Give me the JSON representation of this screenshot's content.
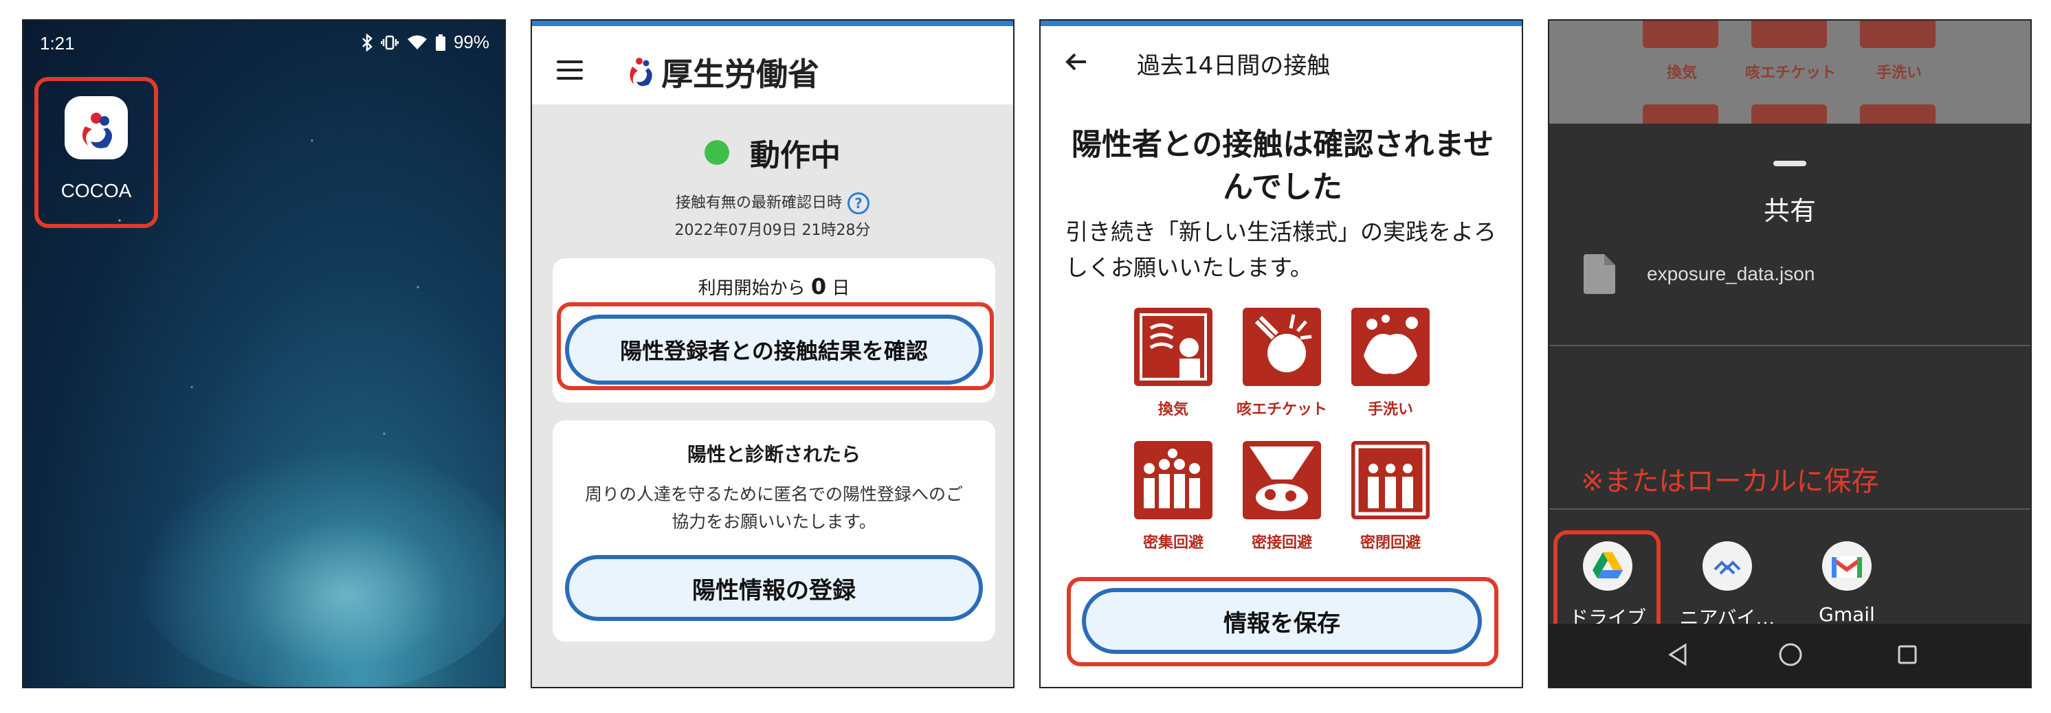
{
  "home": {
    "status_time": "1:21",
    "battery": "99%",
    "app_label": "COCOA"
  },
  "main": {
    "logo_text": "厚生労働省",
    "status": "動作中",
    "last_check_label": "接触有無の最新確認日時",
    "last_check_date": "2022年07月09日 21時28分",
    "days_prefix": "利用開始から",
    "days_count": "0",
    "days_suffix": "日",
    "check_button": "陽性登録者との接触結果を確認",
    "positive_heading": "陽性と診断されたら",
    "positive_desc": "周りの人達を守るために匿名での陽性登録へのご協力をお願いいたします。",
    "register_button": "陽性情報の登録"
  },
  "exposure": {
    "title": "過去14日間の接触",
    "result": "陽性者との接触は確認されませんでした",
    "continue_text": "引き続き「新しい生活様式」の実践をよろしくお願いいたします。",
    "tiles": [
      "換気",
      "咳エチケット",
      "手洗い",
      "密集回避",
      "密接回避",
      "密閉回避"
    ],
    "save_button": "情報を保存"
  },
  "share": {
    "title": "共有",
    "filename": "exposure_data.json",
    "local_note": "※またはローカルに保存",
    "apps": [
      "ドライブ",
      "ニアバイ…",
      "Gmail"
    ]
  },
  "colors": {
    "highlight_red": "#e03a2a",
    "button_blue": "#2b6cb8",
    "active_green": "#3fbe4a",
    "tile_red": "#b32a1e"
  }
}
